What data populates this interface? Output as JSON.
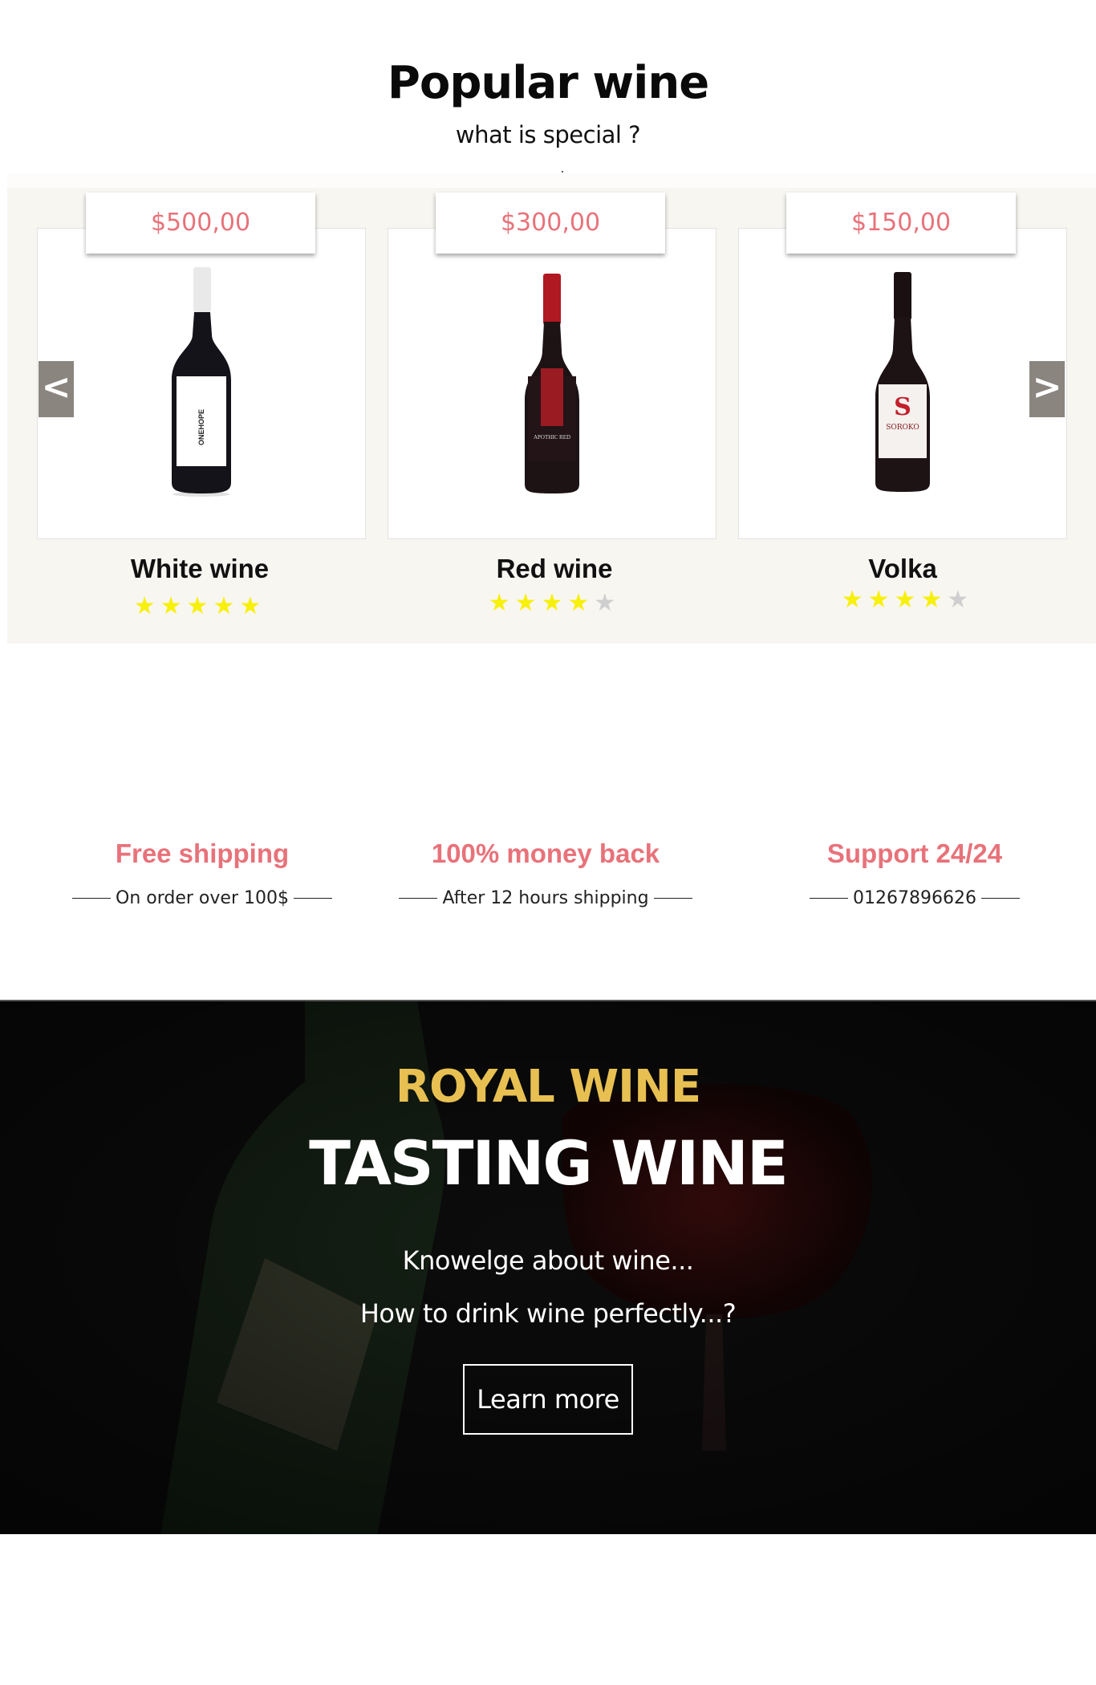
{
  "popular": {
    "title": "Popular wine",
    "subtitle": "what is special ?"
  },
  "carousel": {
    "prev_label": "<",
    "next_label": ">",
    "products": [
      {
        "name": "White wine",
        "price": "$500,00",
        "rating": 5,
        "stars": [
          "★",
          "★",
          "★",
          "★",
          "★"
        ],
        "bottle_label": "ONEHOPE",
        "colors": {
          "capsule": "#e9e9e9",
          "label": "#ffffff",
          "body": "#15131a"
        }
      },
      {
        "name": "Red wine",
        "price": "$300,00",
        "rating": 4,
        "stars": [
          "★",
          "★",
          "★",
          "★",
          "★"
        ],
        "bottle_label": "APOTHIC RED",
        "colors": {
          "capsule": "#b01822",
          "label": "#221417",
          "body": "#1d1315"
        }
      },
      {
        "name": "Volka",
        "price": "$150,00",
        "rating": 4,
        "stars": [
          "★",
          "★",
          "★",
          "★",
          "★"
        ],
        "bottle_label": "SOROKO",
        "colors": {
          "capsule": "#1a1012",
          "label": "#f4f1ee",
          "body": "#1d1315"
        }
      }
    ]
  },
  "features": [
    {
      "title": "Free shipping",
      "note": "On order over 100$"
    },
    {
      "title": "100% money back",
      "note": "After 12 hours shipping"
    },
    {
      "title": "Support 24/24",
      "note": "01267896626"
    }
  ],
  "banner": {
    "brand": "ROYAL WINE",
    "headline": "TASTING WINE",
    "line1": "Knowelge about wine...",
    "line2": "How to drink wine perfectly...?",
    "button": "Learn more"
  },
  "colors": {
    "accent": "#e8727a",
    "gold": "#e8c052",
    "star": "#f7f00b",
    "star_off": "#cfcfcf",
    "carousel_bg": "#f8f6f1",
    "nav_button": "#8b857f"
  }
}
